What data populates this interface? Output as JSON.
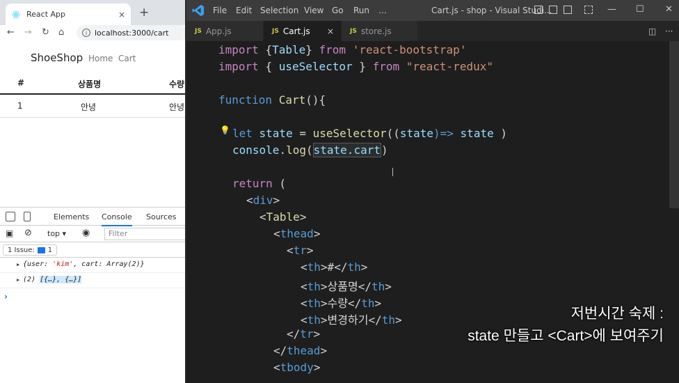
{
  "browser": {
    "tab_title": "React App",
    "tab_close": "×",
    "new_tab": "+",
    "nav": {
      "back": "←",
      "forward": "→",
      "reload": "↻",
      "home": "⌂"
    },
    "url": "localhost:3000/cart",
    "site": {
      "brand": "ShoeShop",
      "links": [
        "Home",
        "Cart"
      ],
      "table": {
        "headers": [
          "#",
          "상품명",
          "수량"
        ],
        "rows": [
          [
            "1",
            "안녕",
            "안녕"
          ]
        ]
      }
    },
    "devtools": {
      "tabs": [
        "Elements",
        "Console",
        "Sources"
      ],
      "context": "top",
      "filter_placeholder": "Filter",
      "issues_label": "1 Issue:",
      "issues_count": "1",
      "logs": [
        {
          "prefix": "{user: ",
          "str": "'kim'",
          "suffix": ", cart: Array(2)}"
        },
        {
          "prefix": "(2) ",
          "hl": "[{…}, {…}]"
        }
      ],
      "prompt": "›"
    }
  },
  "vscode": {
    "menu": [
      "File",
      "Edit",
      "Selection",
      "View",
      "Go",
      "Run",
      "…"
    ],
    "title": "Cart.js - shop - Visual Studi...",
    "window_controls": {
      "minimize": "—",
      "maximize": "☐",
      "close": "✕"
    },
    "tabs": [
      {
        "icon": "JS",
        "label": "App.js"
      },
      {
        "icon": "JS",
        "label": "Cart.js",
        "close": "×"
      },
      {
        "icon": "JS",
        "label": "store.js"
      }
    ],
    "code": {
      "l1": {
        "a": "import ",
        "b": "{",
        "c": "Table",
        "d": "} ",
        "e": "from ",
        "f": "'react-bootstrap'"
      },
      "l2": {
        "a": "import ",
        "b": "{ ",
        "c": "useSelector",
        "d": " } ",
        "e": "from ",
        "f": "\"react-redux\""
      },
      "l4": {
        "a": "function ",
        "b": "Cart",
        "c": "(){"
      },
      "l6": {
        "a": "let ",
        "b": "state",
        "c": " = ",
        "d": "useSelector",
        "e": "((",
        "f": "state",
        "g": ")=> ",
        "h": "state",
        "i": " )"
      },
      "l7": {
        "a": "console",
        "b": ".",
        "c": "log",
        "d": "(",
        "e": "state",
        "f": ".",
        "g": "cart",
        "h": ")"
      },
      "l9": {
        "a": "return",
        "b": " ("
      },
      "l10": {
        "a": "<",
        "b": "div",
        "c": ">"
      },
      "l11": {
        "a": "<",
        "b": "Table",
        "c": ">"
      },
      "l12": {
        "a": "<",
        "b": "thead",
        "c": ">"
      },
      "l13": {
        "a": "<",
        "b": "tr",
        "c": ">"
      },
      "l14": {
        "a": "<",
        "b": "th",
        "c": ">",
        "d": "#",
        "e": "</",
        "f": "th",
        "g": ">"
      },
      "l15": {
        "a": "<",
        "b": "th",
        "c": ">",
        "d": "상품명",
        "e": "</",
        "f": "th",
        "g": ">"
      },
      "l16": {
        "a": "<",
        "b": "th",
        "c": ">",
        "d": "수량",
        "e": "</",
        "f": "th",
        "g": ">"
      },
      "l17": {
        "a": "<",
        "b": "th",
        "c": ">",
        "d": "변경하기",
        "e": "</",
        "f": "th",
        "g": ">"
      },
      "l18": {
        "a": "</",
        "b": "tr",
        "c": ">"
      },
      "l19": {
        "a": "</",
        "b": "thead",
        "c": ">"
      },
      "l20": {
        "a": "<",
        "b": "tbody",
        "c": ">"
      }
    }
  },
  "caption": {
    "line1": "저번시간 숙제 :",
    "line2": "state 만들고 <Cart>에 보여주기"
  }
}
